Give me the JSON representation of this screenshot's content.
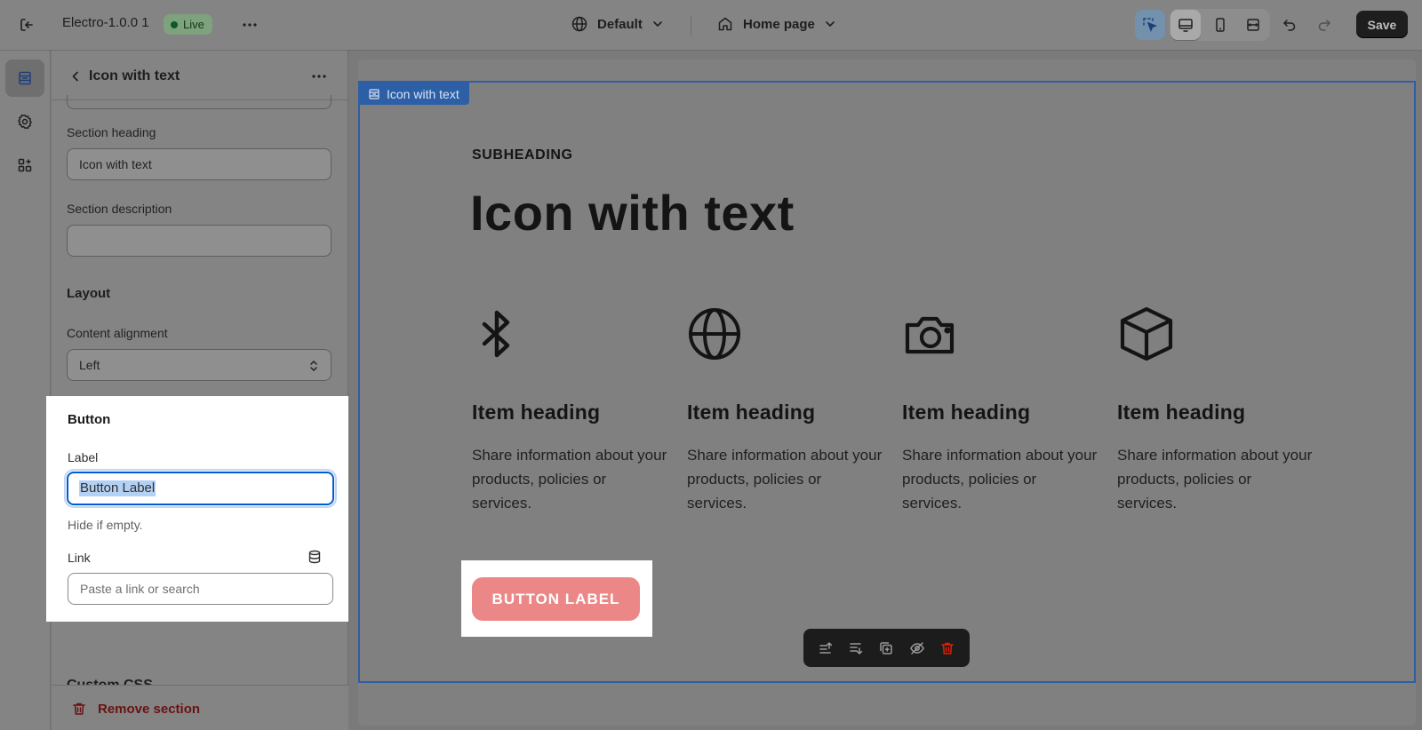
{
  "topbar": {
    "theme_name": "Electro-1.0.0 1",
    "status_badge": "Live",
    "language_selector": "Default",
    "page_selector": "Home page",
    "save_label": "Save"
  },
  "panel": {
    "title": "Icon with text",
    "section_heading": {
      "label": "Section heading",
      "value": "Icon with text"
    },
    "section_description": {
      "label": "Section description",
      "value": ""
    },
    "layout": {
      "title": "Layout",
      "content_alignment": {
        "label": "Content alignment",
        "value": "Left"
      }
    },
    "button": {
      "title": "Button",
      "label_field": {
        "label": "Label",
        "value": "Button Label",
        "help": "Hide if empty."
      },
      "link_field": {
        "label": "Link",
        "placeholder": "Paste a link or search"
      }
    },
    "custom_css": "Custom CSS",
    "remove_section": "Remove section"
  },
  "preview": {
    "section_tag": "Icon with text",
    "subheading": "SUBHEADING",
    "heading": "Icon with text",
    "items": [
      {
        "icon": "bluetooth-icon",
        "heading": "Item heading",
        "text": "Share information about your products, policies or services."
      },
      {
        "icon": "globe-icon",
        "heading": "Item heading",
        "text": "Share information about your products, policies or services."
      },
      {
        "icon": "camera-icon",
        "heading": "Item heading",
        "text": "Share information about your products, policies or services."
      },
      {
        "icon": "box-icon",
        "heading": "Item heading",
        "text": "Share information about your products, policies or services."
      }
    ],
    "button_label": "BUTTON LABEL"
  },
  "colors": {
    "accent": "#005bd3",
    "section_outline": "#2d5fa6",
    "cta_button": "#ec8787",
    "danger": "#e51c00"
  }
}
